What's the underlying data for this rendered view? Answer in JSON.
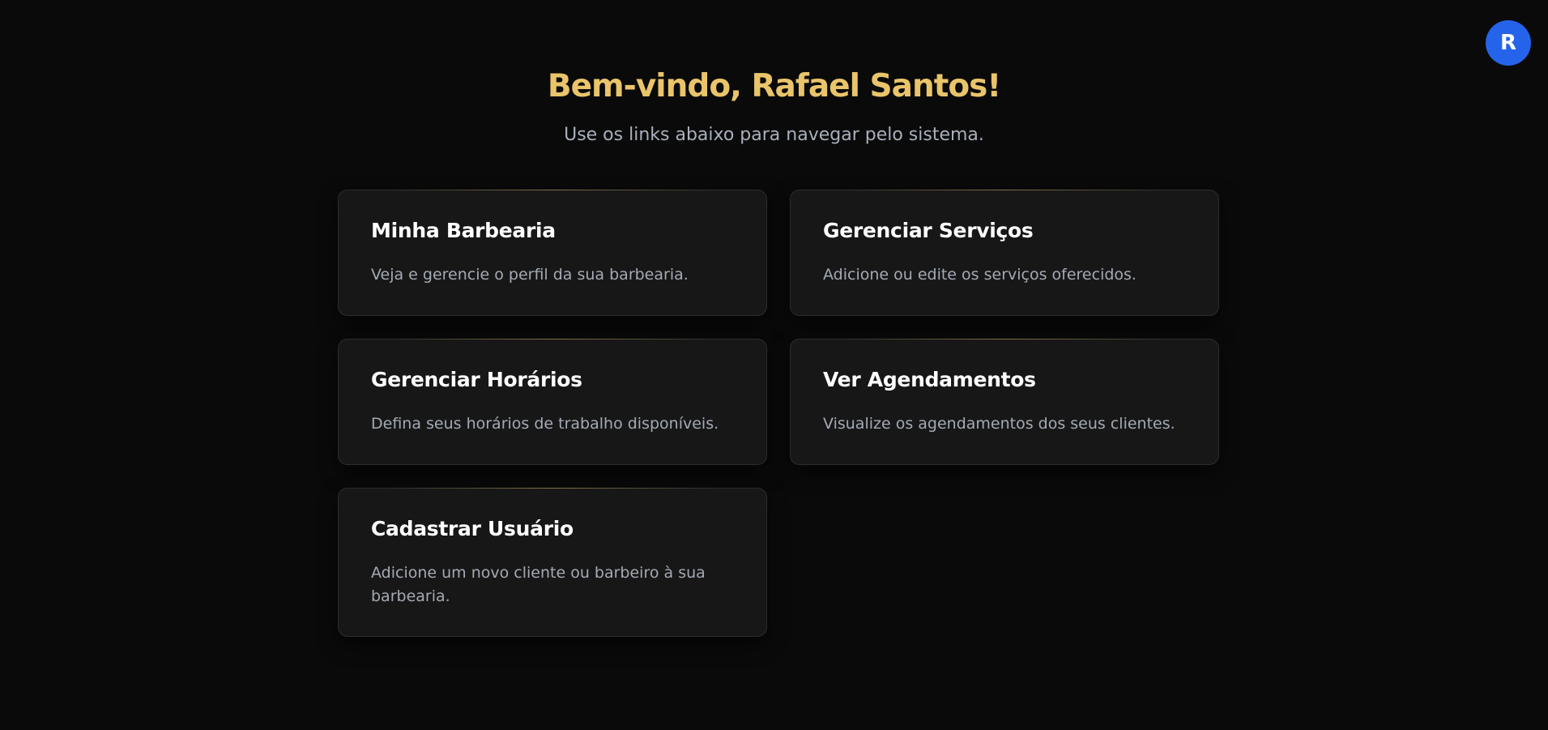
{
  "user": {
    "avatar_initial": "R"
  },
  "header": {
    "title": "Bem-vindo, Rafael Santos!",
    "subtitle": "Use os links abaixo para navegar pelo sistema."
  },
  "cards": [
    {
      "title": "Minha Barbearia",
      "description": "Veja e gerencie o perfil da sua barbearia."
    },
    {
      "title": "Gerenciar Serviços",
      "description": "Adicione ou edite os serviços oferecidos."
    },
    {
      "title": "Gerenciar Horários",
      "description": "Defina seus horários de trabalho disponíveis."
    },
    {
      "title": "Ver Agendamentos",
      "description": "Visualize os agendamentos dos seus clientes."
    },
    {
      "title": "Cadastrar Usuário",
      "description": "Adicione um novo cliente ou barbeiro à sua barbearia."
    }
  ],
  "colors": {
    "background": "#0a0a0a",
    "accent_gold": "#e9c46a",
    "avatar_blue": "#2563eb",
    "card_background": "#171717"
  }
}
